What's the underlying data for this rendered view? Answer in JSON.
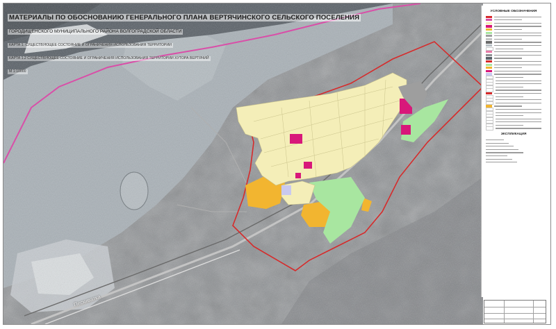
{
  "header": {
    "title_line1": "МАТЕРИАЛЫ ПО ОБОСНОВАНИЮ ГЕНЕРАЛЬНОГО ПЛАНА ВЕРТЯЧИНСКОГО СЕЛЬСКОГО ПОСЕЛЕНИЯ",
    "title_line2": "ГОРОДИЩЕНСКОГО МУНИЦИПАЛЬНОГО РАЙОНА ВОЛГОГРАДСКОЙ ОБЛАСТИ",
    "subtitle_line1": "КАРТА 1. СУЩЕСТВУЮЩЕЕ СОСТОЯНИЕ И ОГРАНИЧЕНИЯ ИСПОЛЬЗОВАНИЯ ТЕРРИТОРИИ",
    "subtitle_line2": "КАРТА 1.2 СУЩЕСТВУЮЩЕЕ СОСТОЯНИЕ И ОГРАНИЧЕНИЯ ИСПОЛЬЗОВАНИЯ ТЕРРИТОРИИ ХУТОРА ВЕРТЯЧИЙ",
    "scale": "М 1:10000"
  },
  "legend": {
    "title": "УСЛОВНЫЕ ОБОЗНАЧЕНИЯ",
    "explication_title": "ЭКСПЛИКАЦИЯ"
  },
  "map": {
    "road_label": "Пескиватка"
  },
  "colors": {
    "river": "#586068",
    "floodplain": "#a6aeb4",
    "steppe": "#8f9194",
    "residential": "#f4eeb8",
    "public_center": "#d8187a",
    "industrial": "#f2b530",
    "green": "#a9e6a0",
    "boundary": "#d62b2b",
    "admin_line": "#d94fa8",
    "road": "#c1c1c1"
  }
}
